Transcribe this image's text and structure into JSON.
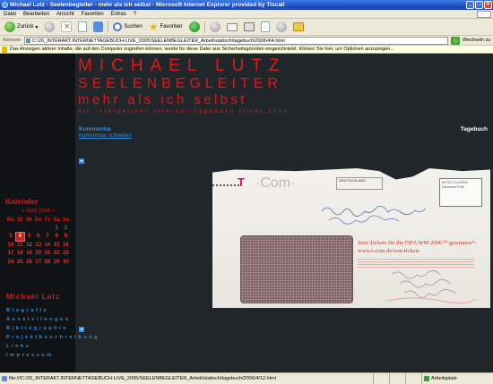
{
  "window": {
    "title": "Michael Lutz - Seelenbegleiter - mehr als ich selbst - Microsoft Internet Explorer provided by Tiscali"
  },
  "menu": {
    "items": [
      "Datei",
      "Bearbeiten",
      "Ansicht",
      "Favoriten",
      "Extras",
      "?"
    ]
  },
  "toolbar": {
    "back_label": "Zurück",
    "search_label": "Suchen",
    "favorites_label": "Favoriten"
  },
  "address": {
    "label": "Adresse",
    "url": "C:\\26_INTERAKT.INTERNETTAGEBUCH-LIVE_2005\\SEELENBEGLEITER_Arbeit\\statisch\\tagebuch\\2006\\4\\4.html",
    "go_label": "Wechseln zu"
  },
  "infobar": {
    "text": "Das Anzeigen aktiver Inhalte, die auf den Computer zugreifen können, wurde für diese Datei aus Sicherheitsgründen eingeschränkt. Klicken Sie hier, um Optionen anzuzeigen..."
  },
  "site": {
    "logo_line1": "MICHAEL LUTZ",
    "logo_line2": "SEELENBEGLEITER",
    "logo_line3": "mehr als ich selbst",
    "logo_line4": "ein interaktives Internet-Tagebuch (live) 2006",
    "kommentar_title": "Kommentar",
    "kommentar_link": "Kommentar schreiben",
    "tagebuch_label": "Tagebuch"
  },
  "calendar": {
    "title": "Kalender",
    "month_label": "« April 2006 »",
    "weekdays": [
      "Mo",
      "Di",
      "Mi",
      "Do",
      "Fr",
      "Sa",
      "So"
    ],
    "weeks": [
      [
        "",
        "",
        "",
        "",
        "",
        "1",
        "2"
      ],
      [
        "3",
        "4",
        "5",
        "6",
        "7",
        "8",
        "9"
      ],
      [
        "10",
        "11",
        "12",
        "13",
        "14",
        "15",
        "16"
      ],
      [
        "17",
        "18",
        "19",
        "20",
        "21",
        "22",
        "23"
      ],
      [
        "24",
        "25",
        "26",
        "27",
        "28",
        "29",
        "30"
      ]
    ],
    "current_day": "4"
  },
  "nav": {
    "title": "Michael Lutz",
    "items": [
      "Biografie",
      "Ausstellungen",
      "Bibliographie",
      "Projektbeschreibung",
      "Links",
      "Impressum"
    ]
  },
  "envelope": {
    "brand_t": "T",
    "brand_com": "·Com·",
    "postmark_text": "DEUTSCHLAND",
    "stamp_text": "ePOST CLASSIC Deutsche Post",
    "promo_line1": "Jetzt Tickets für die FIFA WM 2006™ gewinnen*:",
    "promo_line2": "www.t-com.de/wm-tickets"
  },
  "status": {
    "url": "file:///C:/26_INTERAKT.INTERNETTAGEBUCH-LIVE_2005/SEELENBEGLEITER_Arbeit/statisch/tagebuch/2006/4/12.html",
    "zone": "Arbeitsplatz"
  }
}
